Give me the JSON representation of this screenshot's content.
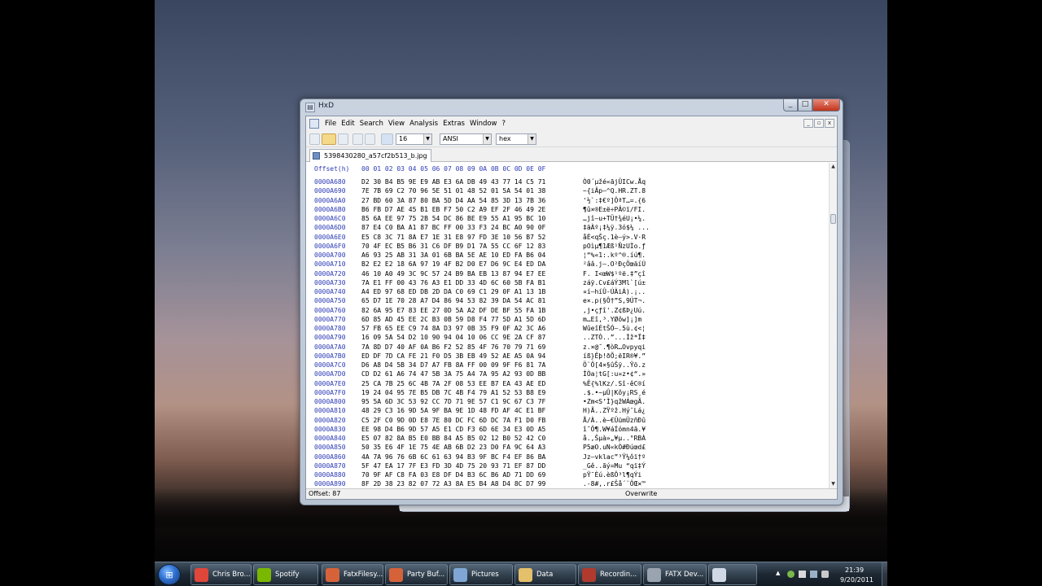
{
  "window": {
    "title": "HxD",
    "icon": "hxd-app-icon"
  },
  "menu": [
    "File",
    "Edit",
    "Search",
    "View",
    "Analysis",
    "Extras",
    "Window",
    "?"
  ],
  "toolbar": {
    "bytes_per_row": "16",
    "charset": "ANSI",
    "offset_base": "hex"
  },
  "tab": {
    "filename": "5398430280_a57cf2b513_b.jpg"
  },
  "editor": {
    "header_offset": "Offset(h)",
    "header_columns": "00 01 02 03 04 05 06 07 08 09 0A 0B 0C 0D 0E 0F",
    "rows": [
      {
        "off": "0000A680",
        "hex": "D2 30 B4 B5 9E E9 AB E3 6A DB 49 43 77 14 C5 71",
        "txt": "Ò0´µžé«ãjÛICw.Åq"
      },
      {
        "off": "0000A690",
        "hex": "7E 7B 69 C2 70 96 5E 51 01 48 52 01 5A 54 01 38",
        "txt": "~{iÂp–^Q.HR.ZT.8"
      },
      {
        "off": "0000A6A0",
        "hex": "27 BD 60 3A 87 80 BA 5D D4 AA 54 85 3D 13 7B 36",
        "txt": "'½`:‡€º]ÔªT…=.{6"
      },
      {
        "off": "0000A6B0",
        "hex": "B6 FB D7 AE 45 B1 EB F7 50 C2 A9 EF 2F 46 49 2E",
        "txt": "¶û×®E±ë÷PÂ©ï/FI."
      },
      {
        "off": "0000A6C0",
        "hex": "85 6A EE 97 75 2B 54 DC 86 BE E9 55 A1 95 BC 10",
        "txt": "…jî—u+TÜ†¾éU¡•¼."
      },
      {
        "off": "0000A6D0",
        "hex": "87 E4 C0 BA A1 87 BC FF 00 33 F3 24 BC A0 90 0F",
        "txt": "‡äÀº¡‡¼ÿ.3ó$¼ ..."
      },
      {
        "off": "0000A6E0",
        "hex": "E5 C8 3C 71 8A E7 1E 31 E8 97 FD 3E 10 56 B7 52",
        "txt": "åÈ<qŠç.1è—ý>.V·R"
      },
      {
        "off": "0000A6F0",
        "hex": "70 4F EC B5 B6 31 C6 DF B9 D1 7A 55 CC 6F 12 83",
        "txt": "pOìµ¶1Æß¹ÑzUÌo.ƒ"
      },
      {
        "off": "0000A700",
        "hex": "A6 93 25 AB 31 3A 01 6B BA 5E AE 10 ED FA B6 04",
        "txt": "¦“%«1:.kº^®.íú¶."
      },
      {
        "off": "0000A710",
        "hex": "B2 E2 E2 18 6A 97 19 4F B2 D0 E7 D6 9C E4 ED DA",
        "txt": "²ââ.j—.O²ÐçÖœäíÚ"
      },
      {
        "off": "0000A720",
        "hex": "46 10 A0 49 3C 9C 57 24 B9 BA EB 13 87 94 E7 EE",
        "txt": "F. I<œW$¹ºë.‡”çî"
      },
      {
        "off": "0000A730",
        "hex": "7A E1 FF 00 43 76 A3 E1 DD 33 4D 6C 60 5B FA B1",
        "txt": "záÿ.Cv£áÝ3Ml`[ú±"
      },
      {
        "off": "0000A740",
        "hex": "A4 ED 97 68 ED DB 2D DA C0 69 C1 29 0F A1 13 1B",
        "txt": "¤í—híÛ-ÚÀiÁ).¡.."
      },
      {
        "off": "0000A750",
        "hex": "65 D7 1E 70 28 A7 D4 86 94 53 82 39 DA 54 AC 81",
        "txt": "e×.p(§Ô†”S‚9ÚT¬."
      },
      {
        "off": "0000A760",
        "hex": "82 6A 95 E7 83 EE 27 0D 5A A2 DF DE BF 55 FA 1B",
        "txt": "‚j•çƒî'.Z¢ßÞ¿Uú."
      },
      {
        "off": "0000A770",
        "hex": "6D 85 AD 45 EE 2C B3 0B 59 D8 F4 77 5D A1 5D 6D",
        "txt": "m…­Eî,³.YØôw]¡]m"
      },
      {
        "off": "0000A780",
        "hex": "57 FB 65 EE C9 74 8A D3 97 0B 35 F9 0F A2 3C A6",
        "txt": "WûeîÉtŠÓ—.5ù.¢<¦"
      },
      {
        "off": "0000A790",
        "hex": "16 09 5A 54 D2 10 90 94 04 10 06 CC 9E 2A CF 87",
        "txt": "..ZTÒ..”...Ìž*Ï‡"
      },
      {
        "off": "0000A7A0",
        "hex": "7A 8D D7 40 AF 0A B6 F2 52 85 4F 76 70 79 71 69",
        "txt": "z.×@¯.¶òR…Ovpyqi"
      },
      {
        "off": "0000A7B0",
        "hex": "ED DF 7D CA FE 21 F0 D5 3B EB 49 52 AE A5 0A 94",
        "txt": "íß}Êþ!ðÕ;ëIR®¥.”"
      },
      {
        "off": "0000A7C0",
        "hex": "D6 A8 D4 5B 34 D7 A7 FB 8A FF 00 09 9F F6 81 7A",
        "txt": "Ö¨Ô[4×§ûŠÿ..Ÿö.z"
      },
      {
        "off": "0000A7D0",
        "hex": "CD D2 61 A6 74 47 5B 3A 75 A4 7A 95 A2 93 0D BB",
        "txt": "ÍÒa¦tG[:u¤z•¢“.»"
      },
      {
        "off": "0000A7E0",
        "hex": "25 CA 7B 25 6C 4B 7A 2F 08 53 EE B7 EA 43 AE ED",
        "txt": "%Ê{%lKz/.Sî·êC®í"
      },
      {
        "off": "0000A7F0",
        "hex": "19 24 04 95 7E B5 DB 7C 4B F4 79 A1 52 53 B8 E9",
        "txt": ".$.•~µÛ|Kôy¡RS¸é"
      },
      {
        "off": "0000A800",
        "hex": "95 5A 6D 3C 53 92 CC 7D 71 9E 57 C1 9C 67 C3 7F",
        "txt": "•Zm<S’Ì}qžWÁœgÃ."
      },
      {
        "off": "0000A810",
        "hex": "48 29 C3 16 9D 5A 9F BA 9E 1D 48 FD AF 4C E1 BF",
        "txt": "H)Ã..ZŸºž.Hý¯Lá¿"
      },
      {
        "off": "0000A820",
        "hex": "C5 2F C0 9D 0D E8 7E 80 DC FC 6D DC 7A F1 D0 FB",
        "txt": "Å/À..è~€ÜümÜzñÐû"
      },
      {
        "off": "0000A830",
        "hex": "EE 98 D4 B6 9D 57 A5 E1 CD F3 6D 6E 34 E3 0D A5",
        "txt": "î˜Ô¶.W¥áÍómn4ã.¥"
      },
      {
        "off": "0000A840",
        "hex": "E5 07 82 8A B5 E0 BB 84 A5 B5 02 12 B0 52 42 C0",
        "txt": "å.‚Šµà»„¥µ..°RBÀ"
      },
      {
        "off": "0000A850",
        "hex": "50 35 E6 4F 1E 75 4E AB 6B D2 23 D0 FA 9C 64 A3",
        "txt": "P5æO.uN«kÒ#Ðúœd£"
      },
      {
        "off": "0000A860",
        "hex": "4A 7A 96 76 6B 6C 61 63 94 B3 9F BC F4 EF 86 BA",
        "txt": "Jz–vklac”³Ÿ¼ôï†º"
      },
      {
        "off": "0000A870",
        "hex": "5F 47 EA 17 7F E3 FD 3D 4D 75 20 93 71 EF 87 DD",
        "txt": "_Gê..ãý=Mu “qï‡Ý"
      },
      {
        "off": "0000A880",
        "hex": "70 9F AF C8 FA 03 E8 DF D4 B3 6C B6 AD 71 DD 69",
        "txt": "pŸ¯Èú.èßÔ³l¶­qÝi"
      },
      {
        "off": "0000A890",
        "hex": "8F 2D 38 23 82 07 72 A3 8A E5 B4 A8 D4 8C D7 99",
        "txt": ".-8#‚.r£Šå´¨ÔŒ×™"
      }
    ]
  },
  "status": {
    "offset": "Offset: 87",
    "mode": "Overwrite"
  },
  "taskbar": {
    "items": [
      {
        "label": "Chris Bro...",
        "icon": "chrome-icon",
        "color": "#e0463a"
      },
      {
        "label": "Spotify",
        "icon": "spotify-icon",
        "color": "#7ab800"
      },
      {
        "label": "FatxFilesy...",
        "icon": "app-icon",
        "color": "#d6623a"
      },
      {
        "label": "Party Buf...",
        "icon": "app-icon",
        "color": "#d6623a"
      },
      {
        "label": "Pictures",
        "icon": "folder-icon",
        "color": "#7fa6d4"
      },
      {
        "label": "Data",
        "icon": "folder-icon",
        "color": "#e4c06a"
      },
      {
        "label": "Recordin...",
        "icon": "recorder-icon",
        "color": "#b03a2e"
      },
      {
        "label": "FATX Dev...",
        "icon": "device-icon",
        "color": "#9aa4b0"
      },
      {
        "label": "",
        "icon": "hxd-icon",
        "color": "#cfd8e4"
      }
    ],
    "clock_time": "21:39",
    "clock_date": "9/20/2011"
  }
}
